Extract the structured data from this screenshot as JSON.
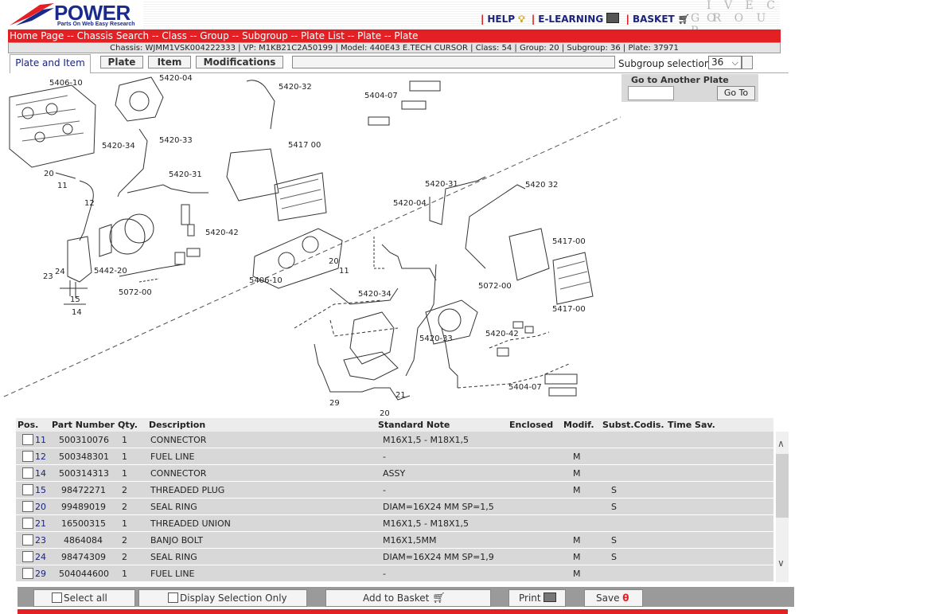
{
  "header": {
    "logo_word": "POWER",
    "logo_tag": "Parts On Web Easy Research",
    "links": {
      "help": "HELP",
      "elearning": "E-LEARNING",
      "basket": "BASKET"
    },
    "brand": "IVECO GROUP",
    "brand_top": "I V E C O",
    "brand_bottom": "G R O U P"
  },
  "breadcrumb": "Home Page -- Chassis Search -- Class -- Group -- Subgroup -- Plate List -- Plate -- Plate",
  "chassis_info": "Chassis: WJMM1VSK004222333 | VP: M1KB21C2A50199 | Model: 440E43 E.TECH CURSOR | Class: 54 | Group: 20 | Subgroup: 36 | Plate: 37971",
  "tabs": {
    "active": "Plate and Item",
    "plate": "Plate",
    "item": "Item",
    "modifications": "Modifications"
  },
  "subgroup": {
    "label": "Subgroup selection",
    "value": "36"
  },
  "goto": {
    "title": "Go to Another Plate",
    "button": "Go To"
  },
  "diagram_labels": [
    "5406-10",
    "5420-04",
    "5420-32",
    "5404-07",
    "5420-34",
    "5420-33",
    "5417 00",
    "5420-31",
    "5420-42",
    "5442-20",
    "5072-00",
    "5406-10",
    "5420-04",
    "5420-31",
    "5420 32",
    "5417-00",
    "5072-00",
    "5420-34",
    "5420-33",
    "5420-42",
    "5417-00",
    "5404-07",
    "20",
    "11",
    "12",
    "24",
    "23",
    "15",
    "14",
    "20",
    "11",
    "29",
    "21",
    "20"
  ],
  "table": {
    "headers": {
      "pos": "Pos.",
      "part": "Part Number",
      "qty": "Qty.",
      "desc": "Description",
      "std": "Standard Note",
      "enclosed": "Enclosed",
      "modif": "Modif.",
      "subst": "Subst.Codis.",
      "time": "Time Sav."
    },
    "rows": [
      {
        "pos": "11",
        "part": "500310076",
        "qty": "1",
        "desc": "CONNECTOR",
        "std": "M16X1,5 - M18X1,5",
        "modif": "",
        "subst": ""
      },
      {
        "pos": "12",
        "part": "500348301",
        "qty": "1",
        "desc": "FUEL LINE",
        "std": "-",
        "modif": "M",
        "subst": ""
      },
      {
        "pos": "14",
        "part": "500314313",
        "qty": "1",
        "desc": "CONNECTOR",
        "std": "ASSY",
        "modif": "M",
        "subst": ""
      },
      {
        "pos": "15",
        "part": "98472271",
        "qty": "2",
        "desc": "THREADED PLUG",
        "std": "-",
        "modif": "M",
        "subst": "S"
      },
      {
        "pos": "20",
        "part": "99489019",
        "qty": "2",
        "desc": "SEAL RING",
        "std": "DIAM=16X24 MM SP=1,5",
        "modif": "",
        "subst": "S"
      },
      {
        "pos": "21",
        "part": "16500315",
        "qty": "1",
        "desc": "THREADED UNION",
        "std": "M16X1,5 - M18X1,5",
        "modif": "",
        "subst": ""
      },
      {
        "pos": "23",
        "part": "4864084",
        "qty": "2",
        "desc": "BANJO BOLT",
        "std": "M16X1,5MM",
        "modif": "M",
        "subst": "S"
      },
      {
        "pos": "24",
        "part": "98474309",
        "qty": "2",
        "desc": "SEAL RING",
        "std": "DIAM=16X24 MM SP=1,9",
        "modif": "M",
        "subst": "S"
      },
      {
        "pos": "29",
        "part": "504044600",
        "qty": "1",
        "desc": "FUEL LINE",
        "std": "-",
        "modif": "M",
        "subst": ""
      }
    ]
  },
  "buttons": {
    "select_all": "Select all",
    "display_selection": "Display Selection Only",
    "add_basket": "Add to Basket",
    "print": "Print",
    "save": "Save"
  },
  "colors": {
    "red": "#e32124",
    "navy": "#1a237e"
  }
}
